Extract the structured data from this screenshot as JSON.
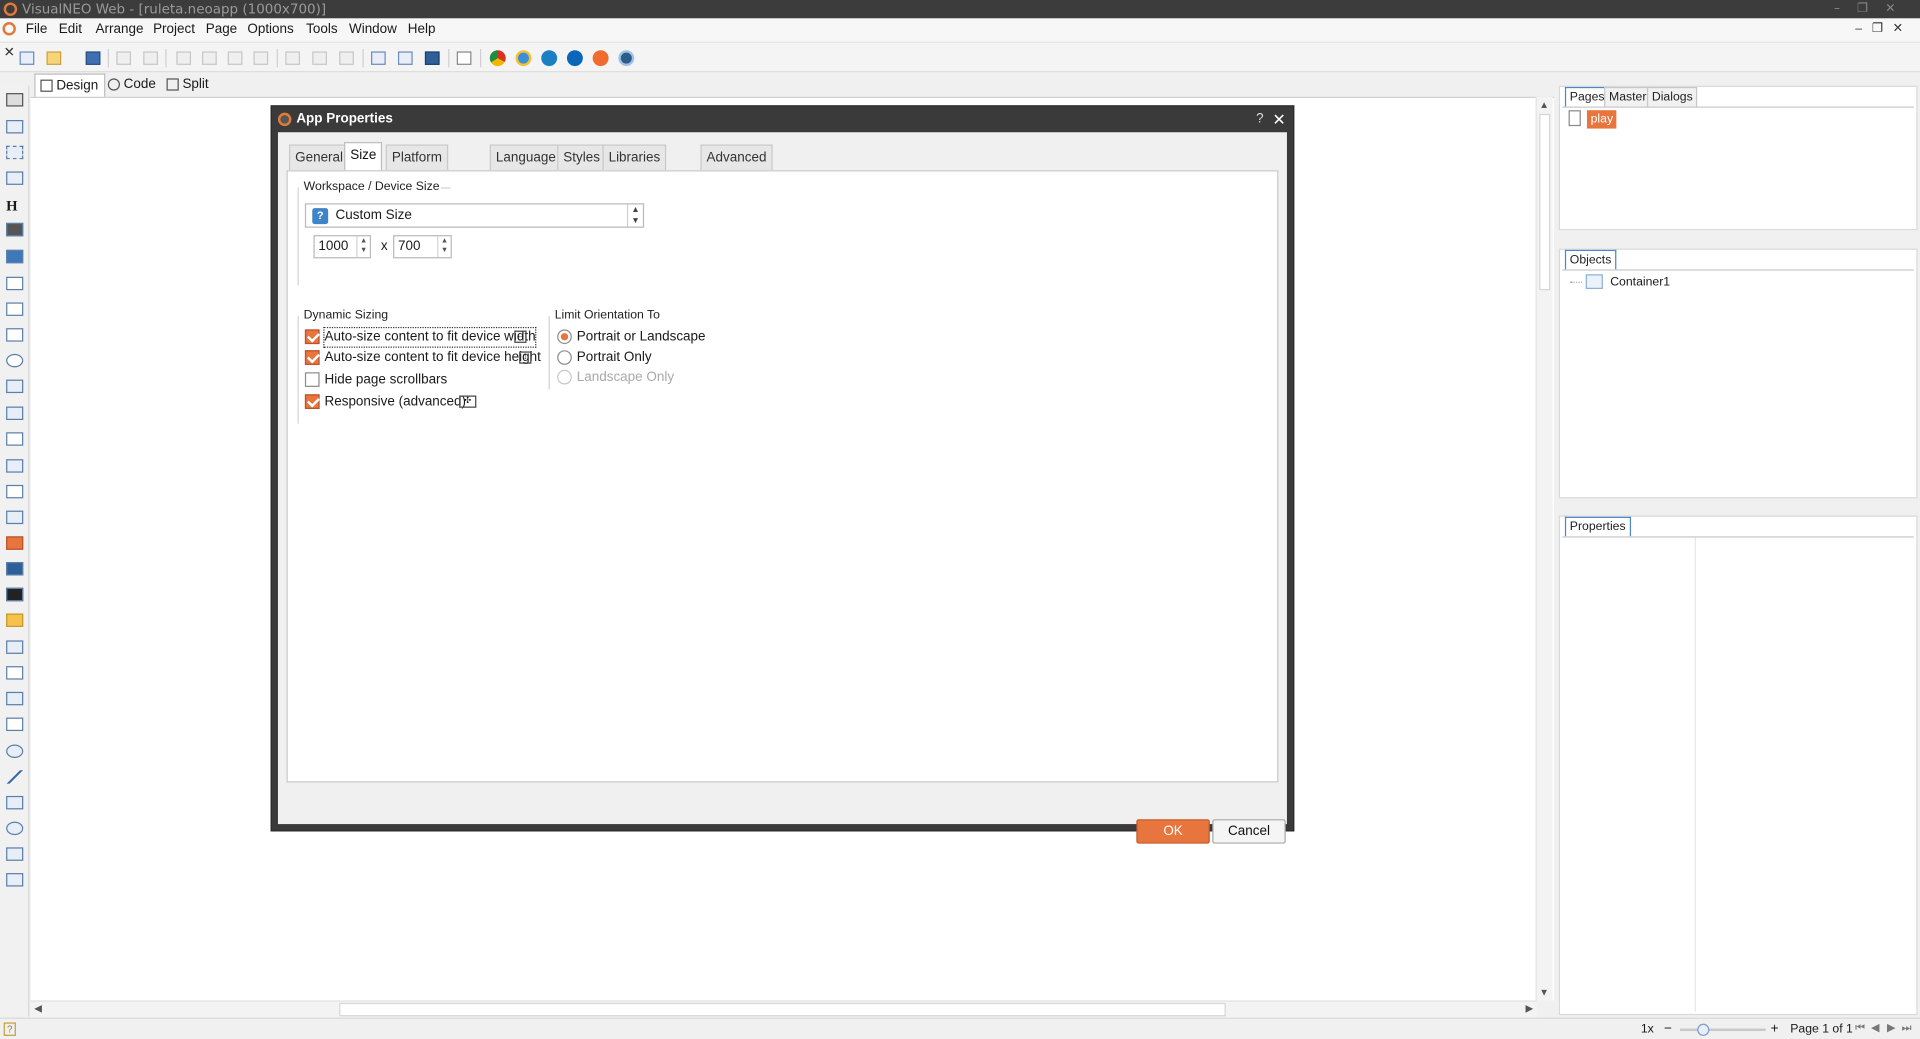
{
  "window": {
    "title": "VisualNEO Web - [ruleta.neoapp (1000x700)]"
  },
  "menu": [
    "File",
    "Edit",
    "Arrange",
    "Project",
    "Page",
    "Options",
    "Tools",
    "Window",
    "Help"
  ],
  "view_tabs": [
    "Design",
    "Code",
    "Split"
  ],
  "right_panels": {
    "pages_tabs": [
      "Pages",
      "Master",
      "Dialogs"
    ],
    "page_item": "play",
    "objects_tab": "Objects",
    "object_item": "Container1",
    "properties_tab": "Properties"
  },
  "status": {
    "zoom": "1x",
    "minus": "−",
    "plus": "+",
    "page_indicator": "Page 1 of 1"
  },
  "dialog": {
    "title": "App Properties",
    "help": "?",
    "close": "✕",
    "tabs": [
      "General",
      "Size",
      "Platform Options",
      "Language",
      "Styles",
      "Libraries / Files",
      "Advanced"
    ],
    "active_tab": "Size",
    "workspace_group": "Workspace / Device Size",
    "device_size": "Custom Size",
    "width": "1000",
    "height": "700",
    "x_sep": "x",
    "dynamic_group": "Dynamic Sizing",
    "checkboxes": [
      {
        "label": "Auto-size content to fit device width",
        "checked": true
      },
      {
        "label": "Auto-size content to fit device height",
        "checked": true
      },
      {
        "label": "Hide page scrollbars",
        "checked": false
      },
      {
        "label": "Responsive (advanced)",
        "checked": true
      }
    ],
    "orientation_group": "Limit Orientation To",
    "radios": [
      {
        "label": "Portrait or Landscape",
        "selected": true,
        "enabled": true
      },
      {
        "label": "Portrait Only",
        "selected": false,
        "enabled": true
      },
      {
        "label": "Landscape Only",
        "selected": false,
        "enabled": false
      }
    ],
    "ok": "OK",
    "cancel": "Cancel"
  },
  "colors": {
    "accent": "#e8753d",
    "title_bar": "#3c3c3c"
  }
}
